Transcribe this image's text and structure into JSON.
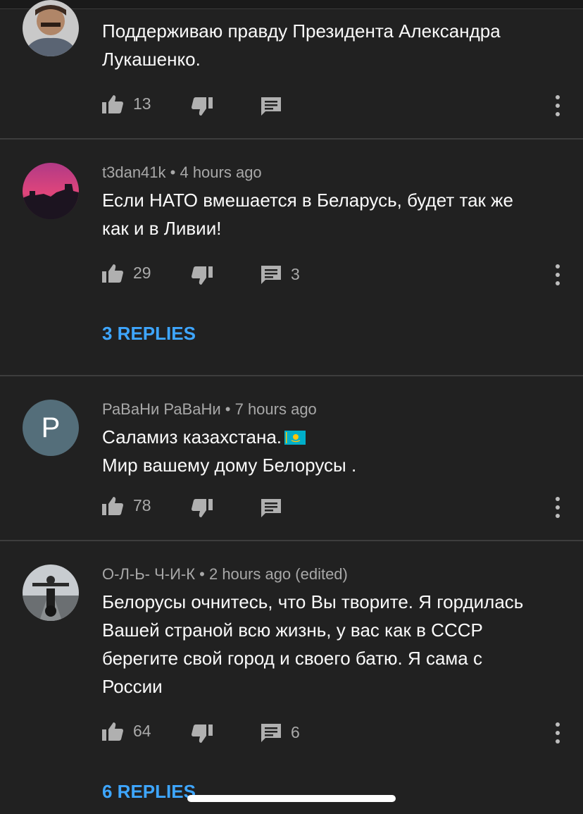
{
  "comments": [
    {
      "author": "",
      "time": "",
      "lines": [
        "Поддерживаю правду Президента Александра",
        "Лукашенко."
      ],
      "likes": "13",
      "reply_count": "",
      "replies_link": ""
    },
    {
      "author": "t3dan41k",
      "time": "4 hours ago",
      "lines": [
        "Если НАТО вмешается в Беларусь, будет так же",
        "как и в Ливии!"
      ],
      "likes": "29",
      "reply_count": "3",
      "replies_link": "3 REPLIES"
    },
    {
      "author": "РаВаНи РаВаНи",
      "time": "7 hours ago",
      "avatar_letter": "P",
      "lines": [
        "Саламиз казахстана.",
        "Мир вашему дому Белорусы ."
      ],
      "likes": "78",
      "reply_count": "",
      "replies_link": ""
    },
    {
      "author": "О-Л-Ь- Ч-И-К",
      "time": "2 hours ago (edited)",
      "lines": [
        "Белорусы очнитесь, что Вы творите. Я гордилась",
        "Вашей страной всю жизнь, у вас как в СССР",
        "берегите свой город и своего батю. Я сама с",
        "России"
      ],
      "likes": "64",
      "reply_count": "6",
      "replies_link": "6 REPLIES"
    }
  ],
  "separator": " • ",
  "colors": {
    "background": "#212121",
    "link": "#3ea6ff",
    "meta": "#a8a8a8",
    "divider": "#3d3d3d"
  },
  "icons": [
    "like-icon",
    "dislike-icon",
    "reply-icon",
    "more-icon",
    "kazakhstan-flag-emoji"
  ]
}
